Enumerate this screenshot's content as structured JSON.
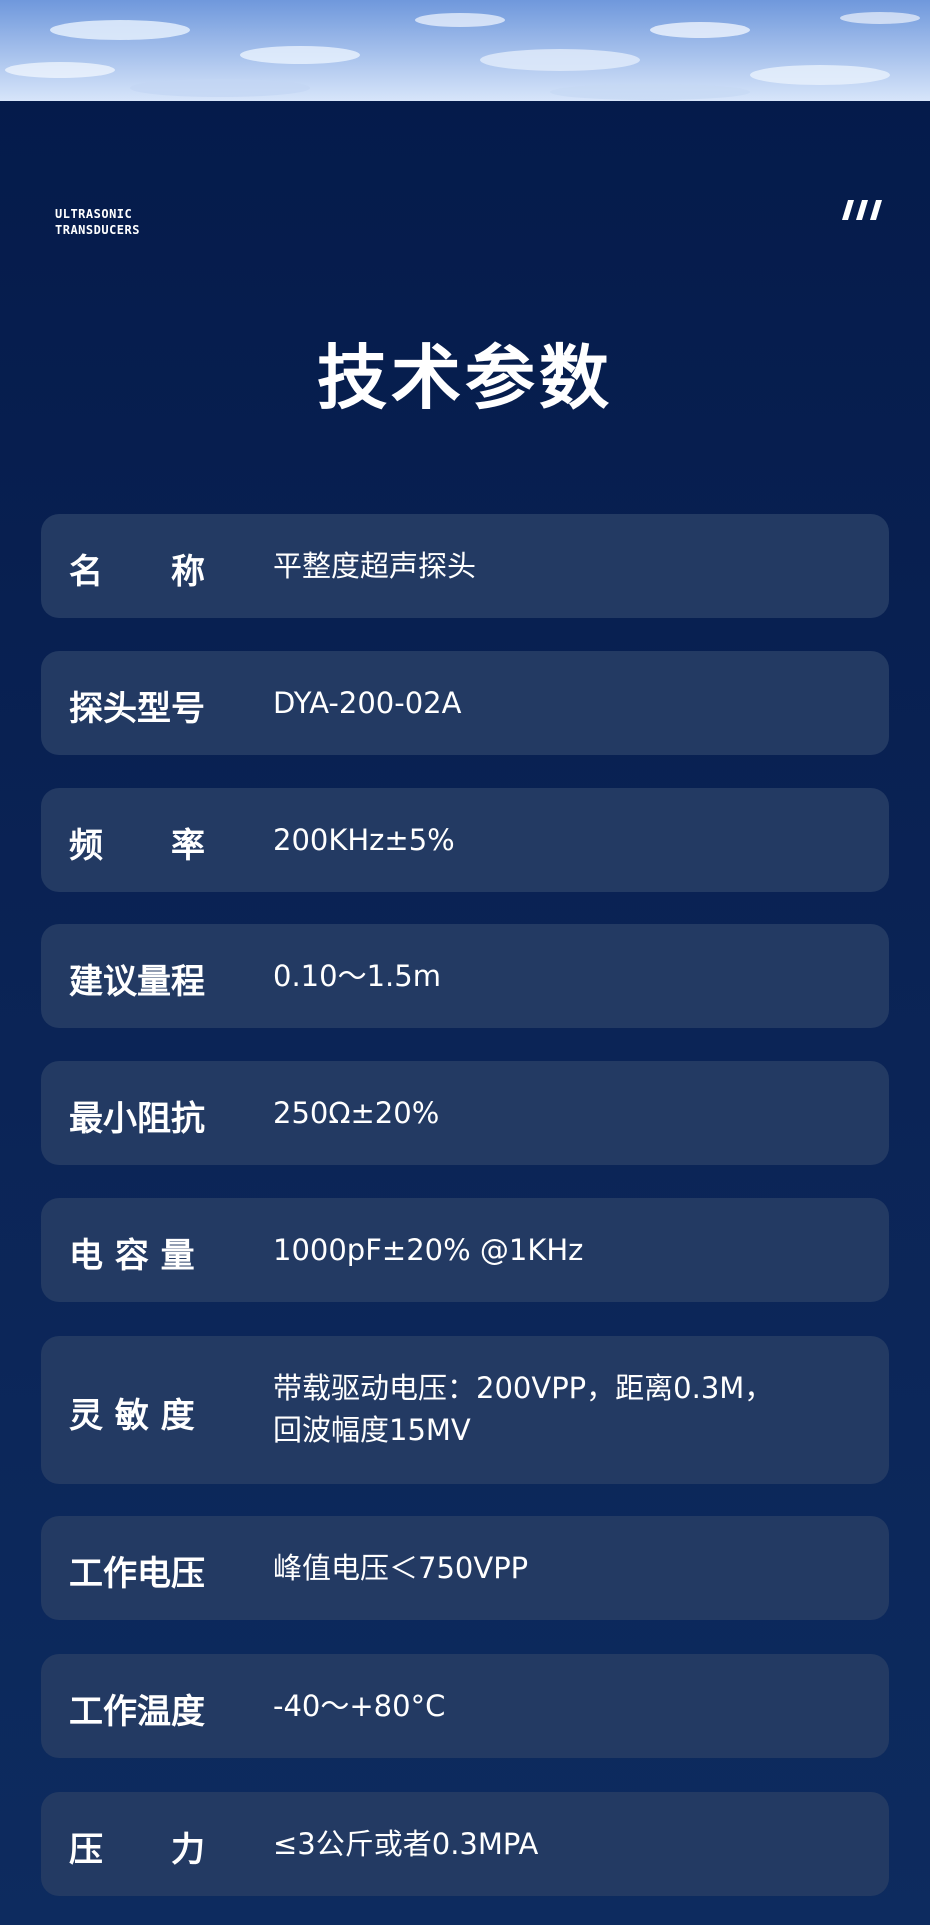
{
  "header": {
    "brand_line1": "ULTRASONIC",
    "brand_line2": "TRANSDUCERS"
  },
  "title": "技术参数",
  "specs": [
    {
      "label": "名　　称",
      "value": "平整度超声探头"
    },
    {
      "label": "探头型号",
      "value": "DYA-200-02A"
    },
    {
      "label": "频　　率",
      "value": "200KHz±5%"
    },
    {
      "label": "建议量程",
      "value": "0.10～1.5m"
    },
    {
      "label": "最小阻抗",
      "value": "250Ω±20%"
    },
    {
      "label": "电 容 量",
      "value": "1000pF±20% @1KHz"
    },
    {
      "label": "灵 敏 度",
      "value": "带载驱动电压：200VPP，距离0.3M，",
      "value2": "回波幅度15MV"
    },
    {
      "label": "工作电压",
      "value": "峰值电压＜750VPP"
    },
    {
      "label": "工作温度",
      "value": "-40～+80°C"
    },
    {
      "label": "压　　力",
      "value": "≤3公斤或者0.3MPA"
    }
  ],
  "colors": {
    "background": "#0b2150",
    "row_background": "#233a63",
    "text": "#ffffff"
  }
}
